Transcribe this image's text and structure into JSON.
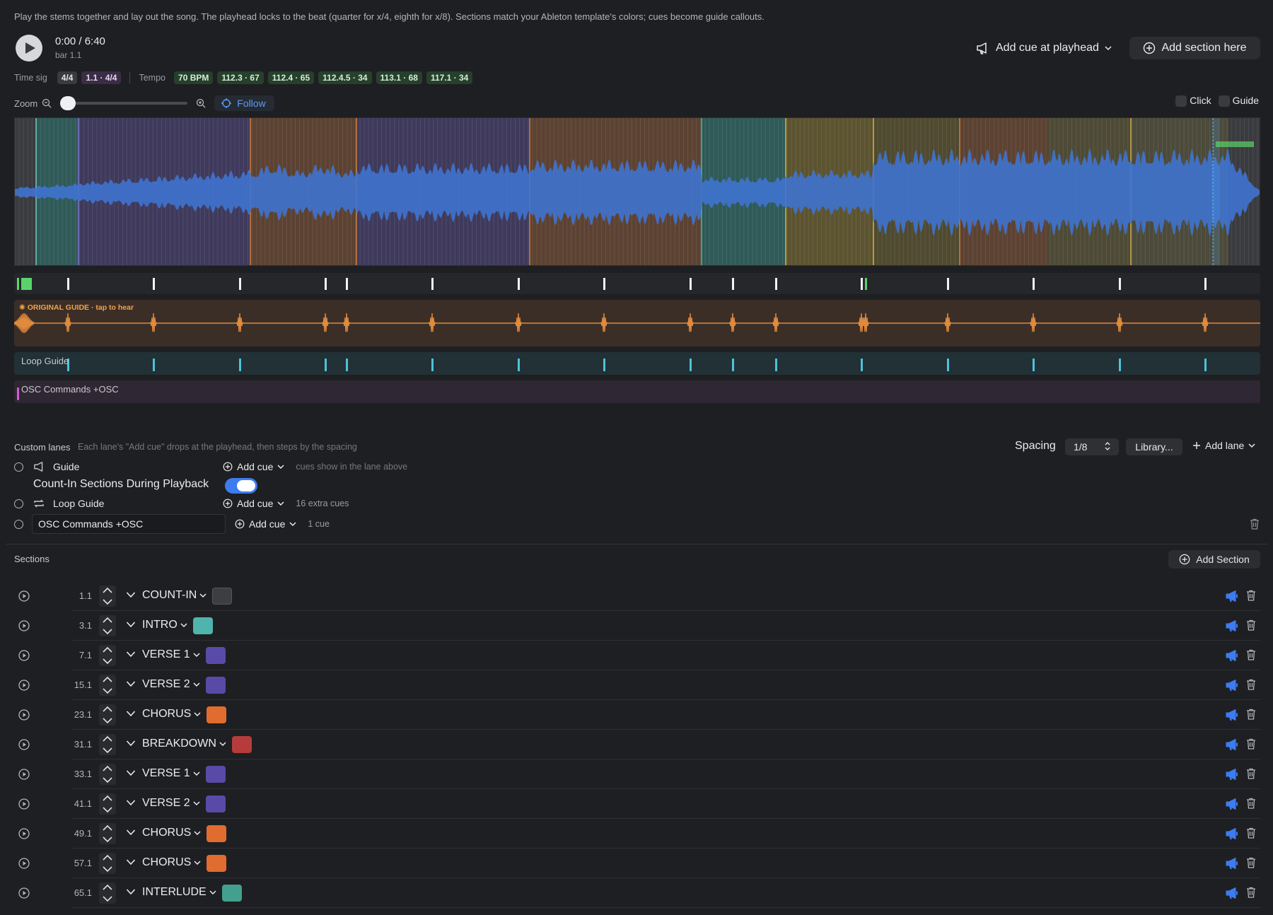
{
  "header": {
    "description": "Play the stems together and lay out the song. The playhead locks to the beat (quarter for x/4, eighth for x/8). Sections match your Ableton template's colors; cues become guide callouts.",
    "time": "0:00 / 6:40",
    "bar": "bar 1.1",
    "add_cue_label": "Add cue at playhead",
    "add_section_label": "Add section here"
  },
  "timesig": {
    "label": "Time sig",
    "values": [
      "4/4",
      "1.1 · 4/4"
    ],
    "tempo_label": "Tempo",
    "tempos": [
      "70 BPM",
      "112.3 · 67",
      "112.4 · 65",
      "112.4.5 · 34",
      "113.1 · 68",
      "117.1 · 34"
    ]
  },
  "zoom": {
    "label": "Zoom",
    "level": 0,
    "follow_label": "Follow",
    "click_label": "Click",
    "guide_label": "Guide"
  },
  "lanes": {
    "guide_title": "ORIGINAL GUIDE · tap to hear",
    "loop_title": "Loop Guide",
    "osc_title": "OSC Commands +OSC"
  },
  "custom_lanes": {
    "title": "Custom lanes",
    "hint": "Each lane's \"Add cue\" drops at the playhead, then steps by the spacing",
    "spacing_label": "Spacing",
    "spacing_value": "1/8",
    "library_label": "Library...",
    "add_lane_label": "Add lane",
    "rows": [
      {
        "name": "Guide",
        "add_label": "Add cue",
        "note": "cues show in the lane above"
      },
      {
        "name": "Loop Guide",
        "add_label": "Add cue",
        "note": "16 extra cues"
      },
      {
        "name": "OSC Commands +OSC",
        "add_label": "Add cue",
        "note": "1 cue"
      }
    ],
    "countin_label": "Count-In Sections During Playback",
    "countin_on": true
  },
  "sections": {
    "title": "Sections",
    "add_label": "Add Section",
    "rows": [
      {
        "bar": "1.1",
        "name": "COUNT-IN",
        "color": "#3d3e42"
      },
      {
        "bar": "3.1",
        "name": "INTRO",
        "color": "#4fb5ac"
      },
      {
        "bar": "7.1",
        "name": "VERSE 1",
        "color": "#5a4aa8"
      },
      {
        "bar": "15.1",
        "name": "VERSE 2",
        "color": "#5a4aa8"
      },
      {
        "bar": "23.1",
        "name": "CHORUS",
        "color": "#e06c30"
      },
      {
        "bar": "31.1",
        "name": "BREAKDOWN",
        "color": "#b63c3c"
      },
      {
        "bar": "33.1",
        "name": "VERSE 1",
        "color": "#5a4aa8"
      },
      {
        "bar": "41.1",
        "name": "VERSE 2",
        "color": "#5a4aa8"
      },
      {
        "bar": "49.1",
        "name": "CHORUS",
        "color": "#e06c30"
      },
      {
        "bar": "57.1",
        "name": "CHORUS",
        "color": "#e06c30"
      },
      {
        "bar": "65.1",
        "name": "INTERLUDE",
        "color": "#43a08f"
      }
    ]
  },
  "colors": {
    "accent": "#3d7cf0",
    "wave": "#3f73cf",
    "guide": "#e08a3c",
    "loop": "#4ec2d8",
    "cue_green": "#5ad46a",
    "osc": "#d45ad0"
  }
}
